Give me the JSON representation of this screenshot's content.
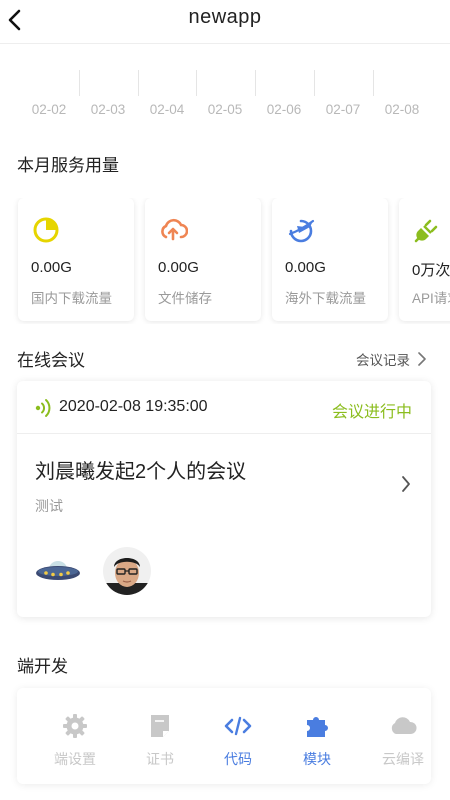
{
  "header": {
    "title": "newapp"
  },
  "chart": {
    "dates": [
      "02-02",
      "02-03",
      "02-04",
      "02-05",
      "02-06",
      "02-07",
      "02-08"
    ]
  },
  "usage": {
    "title": "本月服务用量",
    "cards": [
      {
        "value": "0.00G",
        "label": "国内下载流量",
        "icon": "pie-chart-icon",
        "color": "#e6d500"
      },
      {
        "value": "0.00G",
        "label": "文件储存",
        "icon": "cloud-upload-icon",
        "color": "#ef8553"
      },
      {
        "value": "0.00G",
        "label": "海外下载流量",
        "icon": "globe-plane-icon",
        "color": "#4a7de0"
      },
      {
        "value": "0万次",
        "label": "API请求",
        "icon": "plug-icon",
        "color": "#8bbd1e"
      }
    ]
  },
  "meeting": {
    "section_title": "在线会议",
    "records_link": "会议记录",
    "time": "2020-02-08 19:35:00",
    "status": "会议进行中",
    "title": "刘晨曦发起2个人的会议",
    "subtitle": "测试",
    "participants": [
      "ufo-avatar",
      "person-avatar"
    ]
  },
  "dev": {
    "title": "端开发",
    "items": [
      {
        "label": "端设置",
        "icon": "gear-icon",
        "active": false
      },
      {
        "label": "证书",
        "icon": "certificate-icon",
        "active": false
      },
      {
        "label": "代码",
        "icon": "code-icon",
        "active": true
      },
      {
        "label": "模块",
        "icon": "puzzle-icon",
        "active": true
      },
      {
        "label": "云编译",
        "icon": "cloud-icon",
        "active": false
      }
    ]
  },
  "colors": {
    "accent": "#4a7de0",
    "status_green": "#8bbd1e",
    "muted": "#c8c8c8"
  }
}
